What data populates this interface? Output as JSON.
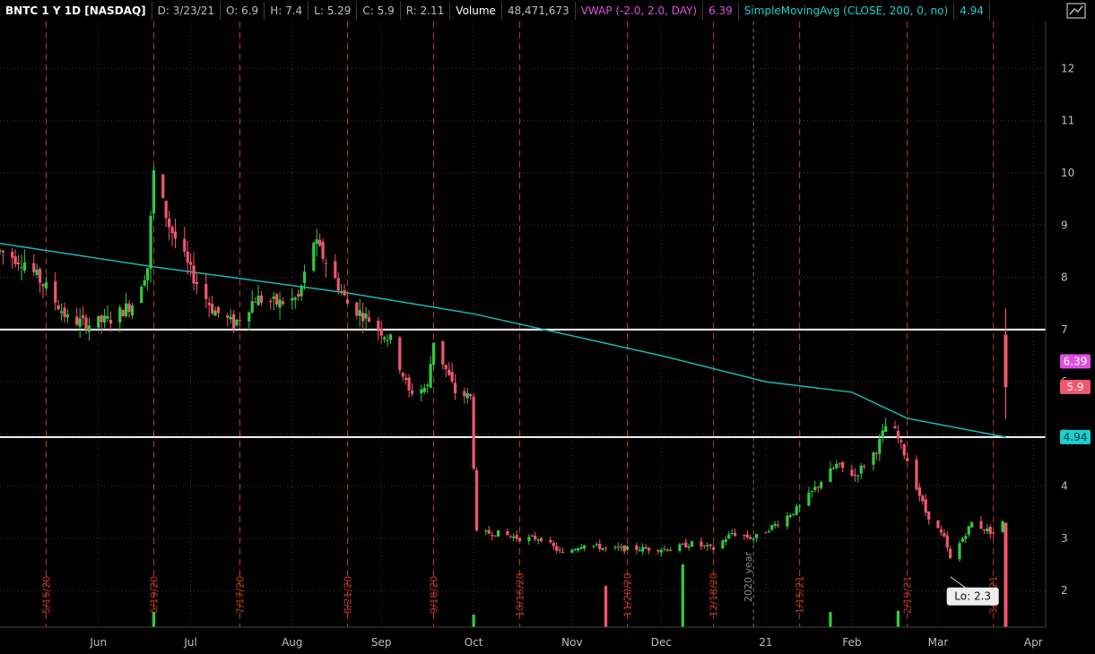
{
  "header": {
    "symbol": "BNTC 1 Y 1D [NASDAQ]",
    "date": "D: 3/23/21",
    "open": "O: 6.9",
    "high": "H: 7.4",
    "low": "L: 5.29",
    "close": "C: 5.9",
    "range": "R: 2.11",
    "volume_label": "Volume",
    "volume_value": "48,471,673",
    "vwap_label": "VWAP (-2.0, 2.0, DAY)",
    "vwap_value": "6.39",
    "sma_label": "SimpleMovingAvg (CLOSE, 200, 0, no)",
    "sma_value": "4.94"
  },
  "colors": {
    "up": "#2ecc40",
    "down": "#f2566f",
    "sma": "#19b8b8",
    "vwap": "#e04ee0",
    "hline": "#ffffff",
    "event_line": "#c0392b",
    "grid": "#3a3a3a",
    "price_tag_close": "#f2566f",
    "price_tag_vwap": "#e04ee0",
    "price_tag_sma": "#19d0d0"
  },
  "chart_data": {
    "type": "candlestick",
    "symbol": "BNTC",
    "ylim": [
      1.3,
      12.9
    ],
    "y_ticks": [
      2,
      3,
      4,
      5,
      6,
      7,
      8,
      9,
      10,
      11,
      12
    ],
    "x_range": [
      "2020-04-30",
      "2021-04-05"
    ],
    "month_ticks": [
      {
        "label": "Jun",
        "date": "2020-06-01"
      },
      {
        "label": "Jul",
        "date": "2020-07-01"
      },
      {
        "label": "Aug",
        "date": "2020-08-03"
      },
      {
        "label": "Sep",
        "date": "2020-09-01"
      },
      {
        "label": "Oct",
        "date": "2020-10-01"
      },
      {
        "label": "Nov",
        "date": "2020-11-02"
      },
      {
        "label": "Dec",
        "date": "2020-12-01"
      },
      {
        "label": "21",
        "date": "2021-01-04"
      },
      {
        "label": "Feb",
        "date": "2021-02-01"
      },
      {
        "label": "Mar",
        "date": "2021-03-01"
      },
      {
        "label": "Apr",
        "date": "2021-04-01"
      }
    ],
    "event_lines": [
      {
        "label": "5/15/20",
        "date": "2020-05-15"
      },
      {
        "label": "6/19/20",
        "date": "2020-06-19"
      },
      {
        "label": "7/17/20",
        "date": "2020-07-17"
      },
      {
        "label": "8/21/20",
        "date": "2020-08-21"
      },
      {
        "label": "9/18/20",
        "date": "2020-09-18"
      },
      {
        "label": "10/16/20",
        "date": "2020-10-16"
      },
      {
        "label": "11/20/20",
        "date": "2020-11-20"
      },
      {
        "label": "12/18/20",
        "date": "2020-12-18"
      },
      {
        "label": "1/15/21",
        "date": "2021-01-15"
      },
      {
        "label": "2/19/21",
        "date": "2021-02-19"
      },
      {
        "label": "3/19/21",
        "date": "2021-03-19"
      }
    ],
    "year_divider": {
      "label": "2020 year",
      "date": "2020-12-31"
    },
    "horizontal_lines": [
      7.0,
      4.94
    ],
    "price_tags": [
      {
        "label": "6.39",
        "value": 6.39,
        "kind": "vwap"
      },
      {
        "label": "5.9",
        "value": 5.9,
        "kind": "close"
      },
      {
        "label": "4.94",
        "value": 4.94,
        "kind": "sma"
      }
    ],
    "low_annotation": {
      "label": "Lo: 2.3",
      "date": "2021-03-05",
      "value": 2.3
    },
    "price_keypoints": [
      [
        "2020-04-30",
        8.5
      ],
      [
        "2020-05-08",
        8.3
      ],
      [
        "2020-05-15",
        7.8
      ],
      [
        "2020-05-22",
        7.2
      ],
      [
        "2020-05-29",
        7.1
      ],
      [
        "2020-06-05",
        7.2
      ],
      [
        "2020-06-12",
        7.5
      ],
      [
        "2020-06-17",
        8.2
      ],
      [
        "2020-06-19",
        10.0
      ],
      [
        "2020-06-24",
        9.0
      ],
      [
        "2020-07-01",
        8.1
      ],
      [
        "2020-07-08",
        7.4
      ],
      [
        "2020-07-15",
        7.1
      ],
      [
        "2020-07-22",
        7.6
      ],
      [
        "2020-07-29",
        7.5
      ],
      [
        "2020-08-05",
        7.6
      ],
      [
        "2020-08-10",
        8.7
      ],
      [
        "2020-08-14",
        8.3
      ],
      [
        "2020-08-21",
        7.5
      ],
      [
        "2020-08-28",
        7.2
      ],
      [
        "2020-09-04",
        6.8
      ],
      [
        "2020-09-10",
        5.8
      ],
      [
        "2020-09-16",
        5.9
      ],
      [
        "2020-09-18",
        6.8
      ],
      [
        "2020-09-25",
        5.8
      ],
      [
        "2020-09-30",
        5.7
      ],
      [
        "2020-10-02",
        3.1
      ],
      [
        "2020-10-09",
        3.1
      ],
      [
        "2020-10-16",
        3.0
      ],
      [
        "2020-10-23",
        3.0
      ],
      [
        "2020-10-30",
        2.7
      ],
      [
        "2020-11-06",
        2.9
      ],
      [
        "2020-11-13",
        2.8
      ],
      [
        "2020-11-20",
        2.8
      ],
      [
        "2020-11-27",
        2.8
      ],
      [
        "2020-12-04",
        2.8
      ],
      [
        "2020-12-11",
        2.9
      ],
      [
        "2020-12-18",
        2.8
      ],
      [
        "2020-12-24",
        3.1
      ],
      [
        "2020-12-31",
        3.0
      ],
      [
        "2021-01-08",
        3.3
      ],
      [
        "2021-01-15",
        3.6
      ],
      [
        "2021-01-22",
        4.1
      ],
      [
        "2021-01-27",
        4.4
      ],
      [
        "2021-02-02",
        4.2
      ],
      [
        "2021-02-09",
        4.7
      ],
      [
        "2021-02-13",
        5.3
      ],
      [
        "2021-02-19",
        4.5
      ],
      [
        "2021-02-25",
        3.5
      ],
      [
        "2021-03-03",
        3.0
      ],
      [
        "2021-03-05",
        2.6
      ],
      [
        "2021-03-12",
        3.3
      ],
      [
        "2021-03-19",
        3.1
      ],
      [
        "2021-03-22",
        3.3
      ],
      [
        "2021-03-23",
        5.9
      ]
    ],
    "last_candle": {
      "date": "2021-03-23",
      "open": 6.9,
      "high": 7.4,
      "low": 5.29,
      "close": 5.9,
      "volume": 48471673
    },
    "sma_keypoints": [
      [
        "2020-04-30",
        8.65
      ],
      [
        "2020-06-19",
        8.2
      ],
      [
        "2020-08-21",
        7.7
      ],
      [
        "2020-10-01",
        7.3
      ],
      [
        "2020-12-01",
        6.5
      ],
      [
        "2021-01-04",
        6.0
      ],
      [
        "2021-02-01",
        5.8
      ],
      [
        "2021-02-19",
        5.3
      ],
      [
        "2021-03-23",
        4.94
      ]
    ],
    "volume_spikes": [
      {
        "date": "2020-06-19",
        "volume": 1200000
      },
      {
        "date": "2020-10-01",
        "volume": 1000000
      },
      {
        "date": "2020-11-13",
        "volume": 3300000
      },
      {
        "date": "2020-12-08",
        "volume": 5000000
      },
      {
        "date": "2021-01-25",
        "volume": 1200000
      },
      {
        "date": "2021-02-16",
        "volume": 1300000
      },
      {
        "date": "2021-03-23",
        "volume": 48471673
      }
    ]
  }
}
